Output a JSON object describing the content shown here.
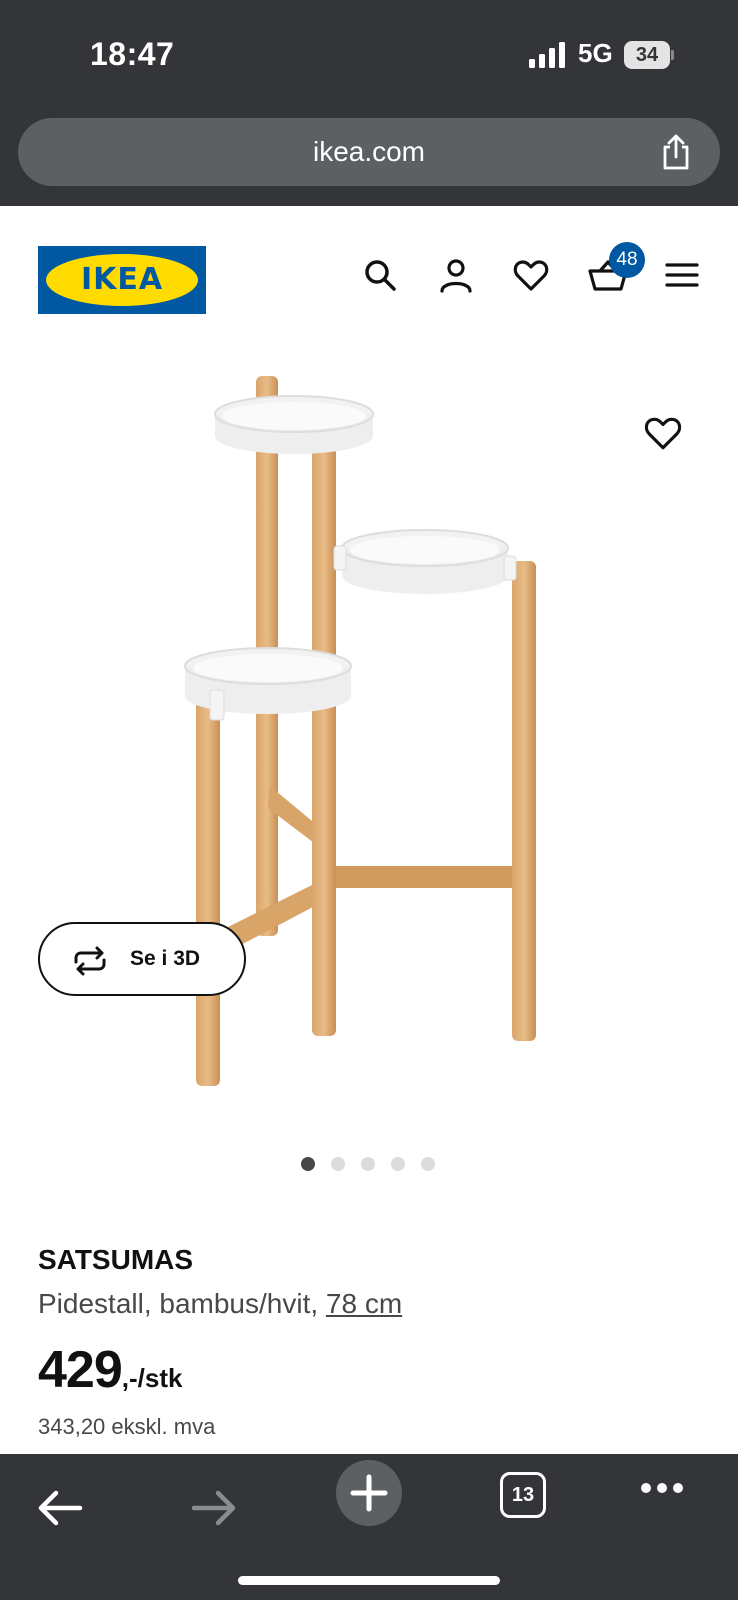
{
  "status_bar": {
    "time": "18:47",
    "network": "5G",
    "battery": "34"
  },
  "browser": {
    "url": "ikea.com",
    "tabs_count": "13"
  },
  "header": {
    "logo_text": "IKEA",
    "cart_count": "48",
    "icons": [
      "search-icon",
      "account-icon",
      "heart-icon",
      "cart-icon",
      "menu-icon"
    ]
  },
  "gallery": {
    "view_3d_label": "Se i 3D",
    "slide_count": 5,
    "active_slide": 1
  },
  "product": {
    "name": "SATSUMAS",
    "description": "Pidestall, bambus/hvit,",
    "size": "78 cm",
    "price": "429",
    "price_unit": ",-/stk",
    "price_ex_vat": "343,20 ekskl. mva"
  },
  "colors": {
    "ikea_blue": "#0058a3",
    "ikea_yellow": "#ffdb00",
    "chrome_dark": "#333538"
  }
}
